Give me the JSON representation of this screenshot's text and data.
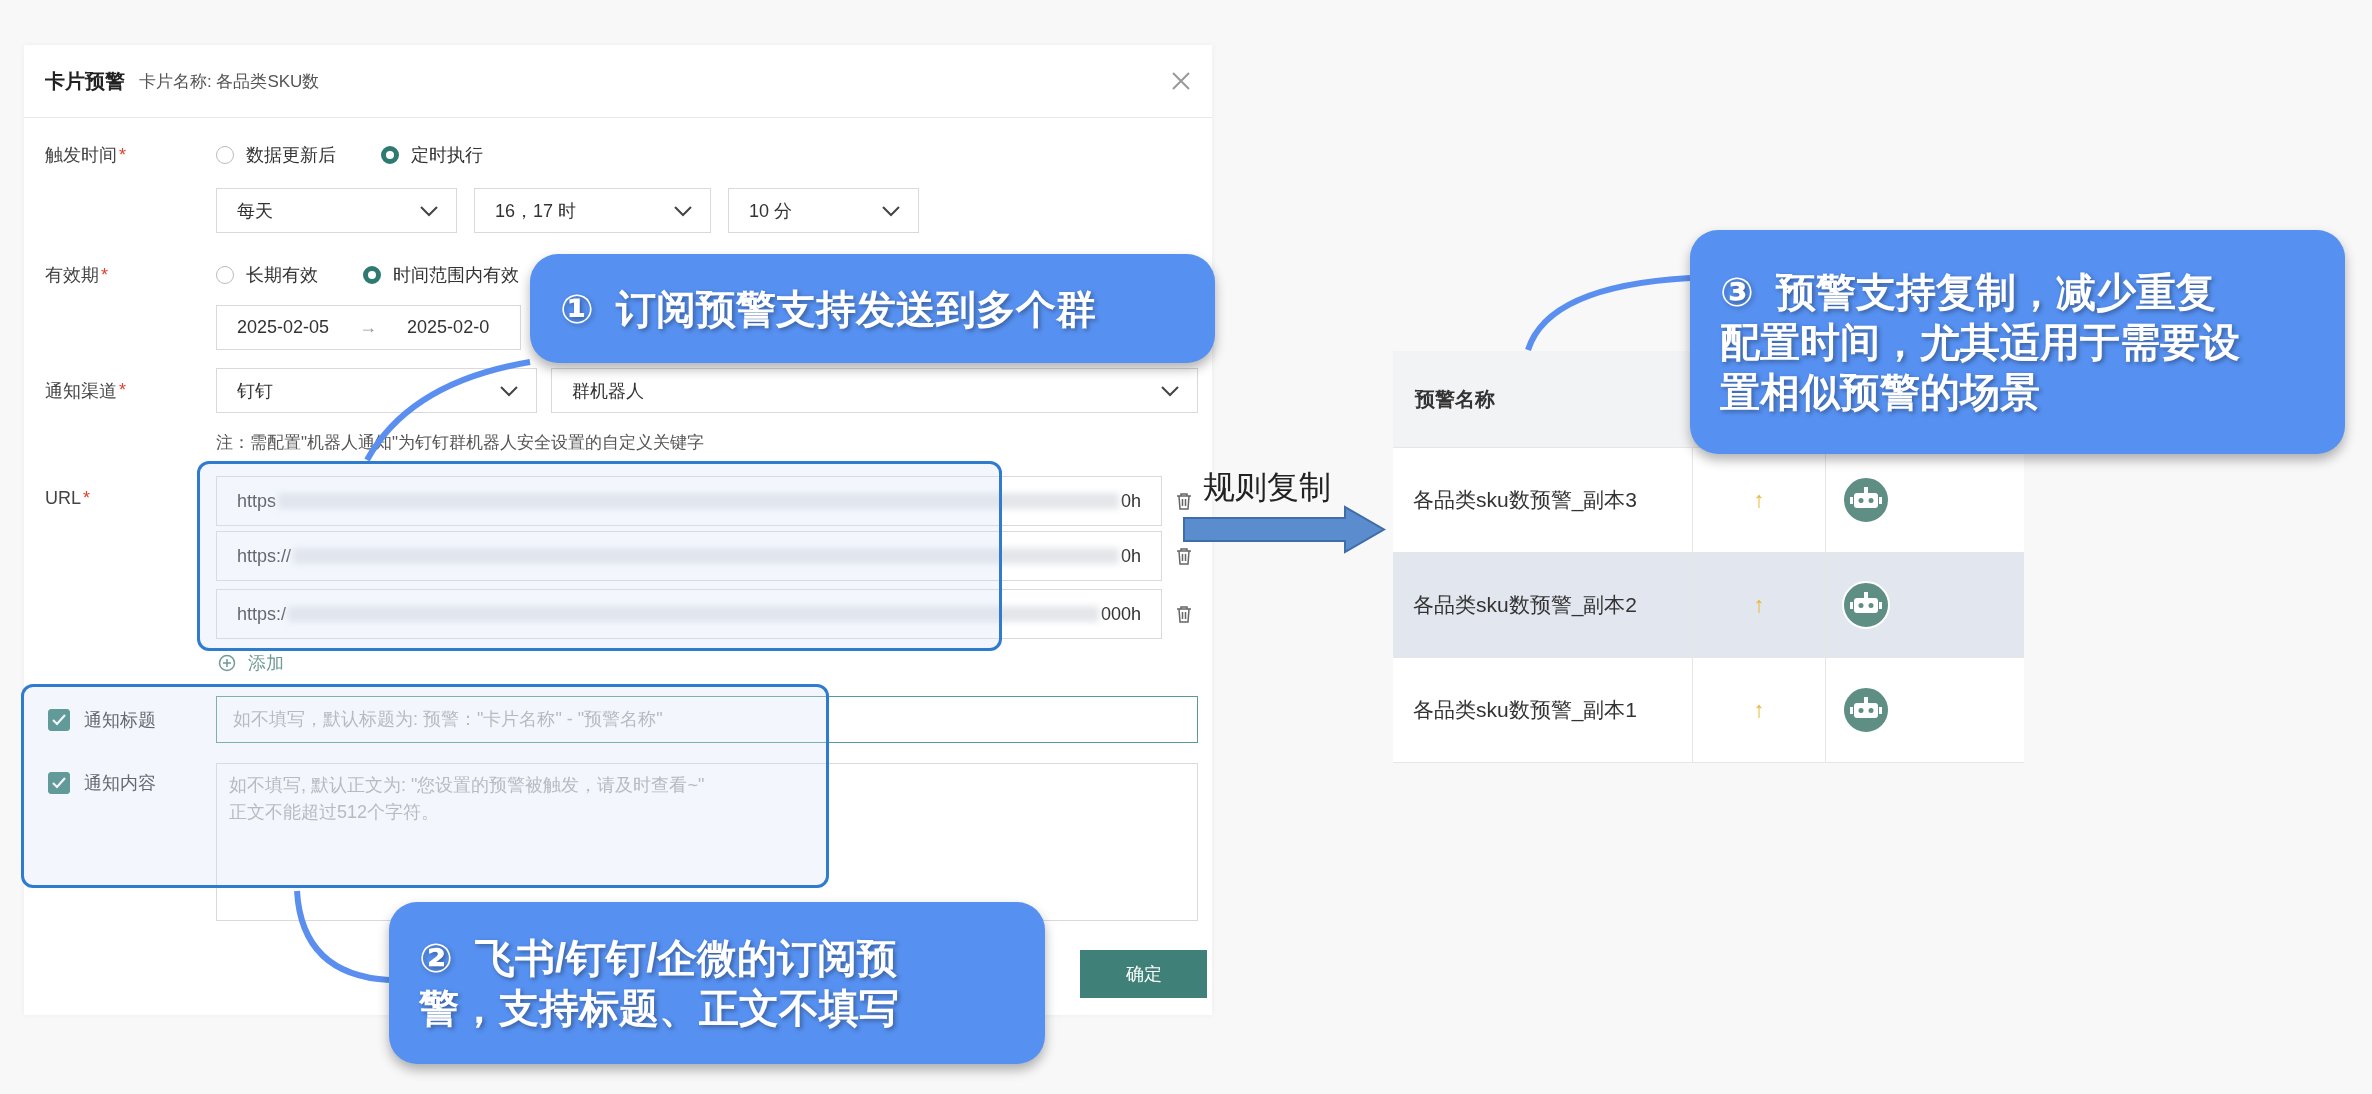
{
  "dialog": {
    "title": "卡片预警",
    "subtitle": "卡片名称: 各品类SKU数",
    "trigger": {
      "label": "触发时间",
      "mark": "*",
      "options": [
        {
          "label": "数据更新后",
          "selected": false
        },
        {
          "label": "定时执行",
          "selected": true
        }
      ],
      "selects": [
        "每天",
        "16，17 时",
        "10 分"
      ]
    },
    "validity": {
      "label": "有效期",
      "mark": "*",
      "options": [
        {
          "label": "长期有效",
          "selected": false
        },
        {
          "label": "时间范围内有效",
          "selected": true
        }
      ],
      "date_start": "2025-02-05",
      "date_separator": "→",
      "date_end": "2025-02-0"
    },
    "channel": {
      "label": "通知渠道",
      "mark": "*",
      "selects": [
        "钉钉",
        "群机器人"
      ],
      "note": "注：需配置\"机器人通知\"为钉钉群机器人安全设置的自定义关键字"
    },
    "url": {
      "label": "URL",
      "mark": "*",
      "urls": [
        {
          "start": "https",
          "end": "0h"
        },
        {
          "start": "https://",
          "end": "0h"
        },
        {
          "start": "https:/",
          "end": "000h"
        }
      ],
      "add": "添加"
    },
    "notify_title": {
      "label": "通知标题",
      "checked": true,
      "placeholder": "如不填写，默认标题为: 预警：\"卡片名称\" - \"预警名称\""
    },
    "notify_content": {
      "label": "通知内容",
      "checked": true,
      "placeholder": "如不填写, 默认正文为: \"您设置的预警被触发，请及时查看~\"\n正文不能超过512个字符。"
    },
    "confirm": "确定"
  },
  "arrow_label": "规则复制",
  "table": {
    "columns": [
      "预警名称"
    ],
    "rows": [
      {
        "name": "各品类sku数预警_副本3",
        "trend": "↑",
        "selected": false
      },
      {
        "name": "各品类sku数预警_副本2",
        "trend": "↑",
        "selected": true
      },
      {
        "name": "各品类sku数预警_副本1",
        "trend": "↑",
        "selected": false
      }
    ]
  },
  "callouts": [
    {
      "text": "①  订阅预警支持发送到多个群"
    },
    {
      "text": "②  飞书/钉钉/企微的订阅预警，支持标题、正文不填写"
    },
    {
      "text": "③  预警支持复制，减少重复配置时间，尤其适用于需要设置相似预警的场景"
    }
  ]
}
